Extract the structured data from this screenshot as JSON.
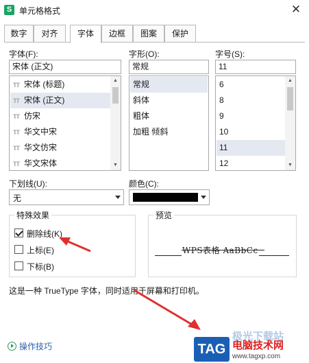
{
  "window": {
    "title": "单元格格式",
    "app_icon": "S",
    "close_glyph": "✕"
  },
  "tabs": [
    {
      "label": "数字",
      "active": false
    },
    {
      "label": "对齐",
      "active": false
    },
    {
      "label": "字体",
      "active": true
    },
    {
      "label": "边框",
      "active": false
    },
    {
      "label": "图案",
      "active": false
    },
    {
      "label": "保护",
      "active": false
    }
  ],
  "font": {
    "label": "字体(F):",
    "value": "宋体 (正文)",
    "items": [
      "宋体 (标题)",
      "宋体 (正文)",
      "仿宋",
      "华文中宋",
      "华文仿宋",
      "华文宋体"
    ],
    "selected_index": 1
  },
  "style": {
    "label": "字形(O):",
    "value": "常规",
    "items": [
      "常规",
      "斜体",
      "粗体",
      "加粗 倾斜"
    ],
    "selected_index": 0
  },
  "size": {
    "label": "字号(S):",
    "value": "11",
    "items": [
      "6",
      "8",
      "9",
      "10",
      "11",
      "12"
    ],
    "selected_index": 4
  },
  "underline": {
    "label": "下划线(U):",
    "value": "无"
  },
  "color": {
    "label": "颜色(C):",
    "value": "#000000"
  },
  "effects": {
    "title": "特殊效果",
    "items": [
      {
        "label": "删除线(K)",
        "checked": true
      },
      {
        "label": "上标(E)",
        "checked": false
      },
      {
        "label": "下标(B)",
        "checked": false
      }
    ]
  },
  "preview": {
    "title": "预览",
    "text": "WPS表格  AaBbCc"
  },
  "info_text": "这是一种 TrueType 字体，同时适用于屏幕和打印机。",
  "tips_label": "操作技巧",
  "watermark": {
    "badge": "TAG",
    "faint": "极光下载站",
    "name": "电脑技术网",
    "url": "www.tagxp.com"
  },
  "accent_colors": {
    "annotation_arrow": "#e03030",
    "link": "#2b5fad",
    "selection": "#e4e9f1"
  },
  "icons": {
    "tt_font_icon": "TT",
    "tips_icon": "play-circle-icon"
  }
}
